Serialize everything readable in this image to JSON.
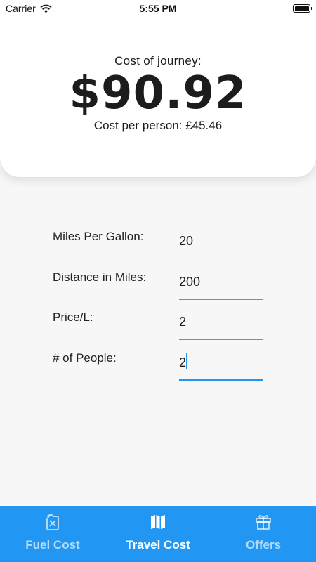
{
  "status_bar": {
    "carrier": "Carrier",
    "time": "5:55 PM"
  },
  "result": {
    "title": "Cost of journey:",
    "amount": "$90.92",
    "per_person": "Cost per person: £45.46"
  },
  "form": {
    "fields": [
      {
        "label": "Miles Per Gallon:",
        "value": "20"
      },
      {
        "label": "Distance in Miles:",
        "value": "200"
      },
      {
        "label": "Price/L:",
        "value": "2"
      },
      {
        "label": "# of People:",
        "value": "2"
      }
    ]
  },
  "nav": {
    "items": [
      {
        "label": "Fuel Cost",
        "icon": "fuel-can-icon"
      },
      {
        "label": "Travel Cost",
        "icon": "map-icon"
      },
      {
        "label": "Offers",
        "icon": "gift-icon"
      }
    ],
    "active": "Travel Cost"
  },
  "colors": {
    "accent": "#2196f3",
    "background": "#f7f7f7",
    "card": "#ffffff"
  }
}
